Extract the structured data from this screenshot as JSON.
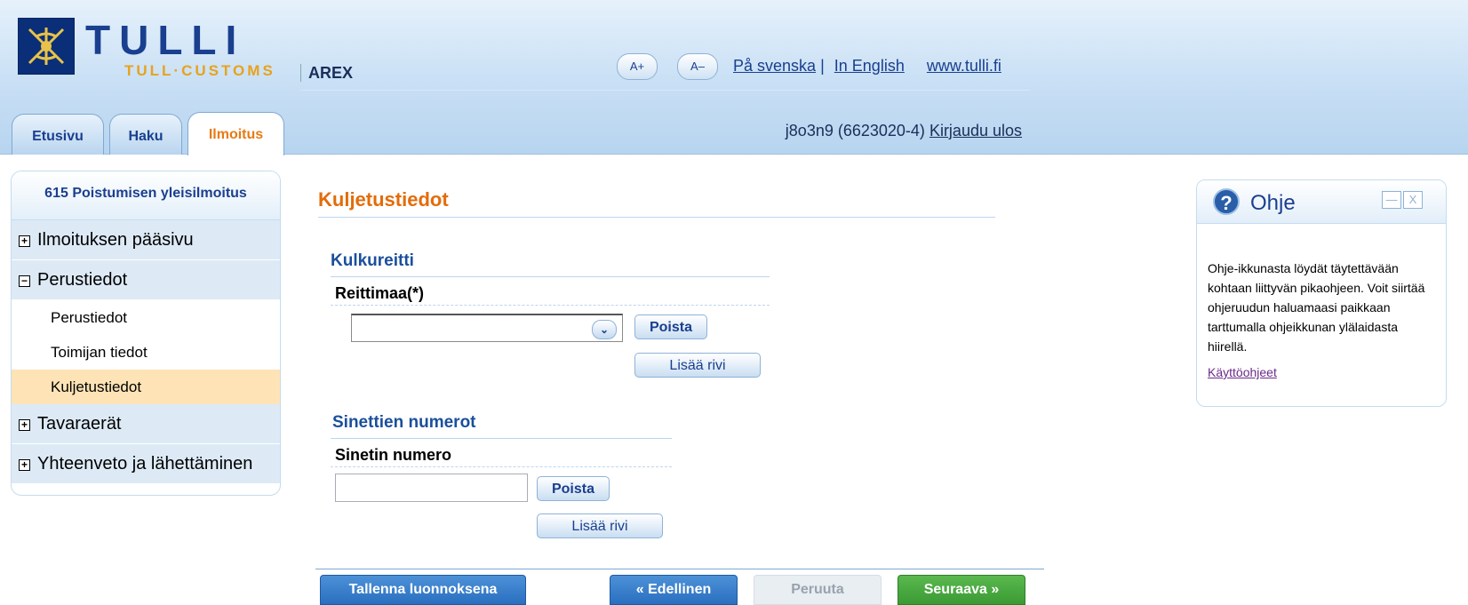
{
  "header": {
    "logo_text": "TULLI",
    "logo_sub": "TULL·CUSTOMS",
    "app_name": "AREX",
    "font_increase": "A+",
    "font_decrease": "A–",
    "lang_sv": "På svenska",
    "separator": "|",
    "lang_en": "In English",
    "site_link": "www.tulli.fi",
    "user": "j8o3n9 (6623020-4)",
    "logout": "Kirjaudu ulos"
  },
  "tabs": [
    {
      "label": "Etusivu"
    },
    {
      "label": "Haku"
    },
    {
      "label": "Ilmoitus",
      "active": true
    }
  ],
  "sidebar": {
    "title": "615 Poistumisen yleisilmoitus",
    "items": [
      {
        "label": "Ilmoituksen pääsivu",
        "toggle": "+"
      },
      {
        "label": "Perustiedot",
        "toggle": "−"
      },
      {
        "label": "Perustiedot"
      },
      {
        "label": "Toimijan tiedot"
      },
      {
        "label": "Kuljetustiedot",
        "active": true
      },
      {
        "label": "Tavaraerät",
        "toggle": "+"
      },
      {
        "label": "Yhteenveto ja lähettäminen",
        "toggle": "+"
      }
    ]
  },
  "main": {
    "page_title": "Kuljetustiedot",
    "route": {
      "section_title": "Kulkureitti",
      "field_label": "Reittimaa(*)",
      "select_value": "",
      "remove_button": "Poista",
      "add_row_button": "Lisää rivi"
    },
    "seals": {
      "section_title": "Sinettien numerot",
      "field_label": "Sinetin numero",
      "input_value": "",
      "remove_button": "Poista",
      "add_row_button": "Lisää rivi"
    },
    "footer": {
      "save_draft": "Tallenna luonnoksena",
      "previous": "Edellinen",
      "cancel": "Peruuta",
      "next": "Seuraava"
    }
  },
  "help": {
    "icon": "?",
    "title": "Ohje",
    "body": "Ohje-ikkunasta löydät täytettävään kohtaan liittyvän pikaohjeen. Voit siirtää ohjeruudun haluamaasi paikkaan tarttumalla ohjeikkunan ylälaidasta hiirellä.",
    "link": "Käyttöohjeet"
  },
  "colors": {
    "accent_orange": "#e36c0a",
    "brand_blue": "#1a3f8f",
    "active_highlight": "#fde3b5",
    "next_green": "#3c9a34"
  }
}
